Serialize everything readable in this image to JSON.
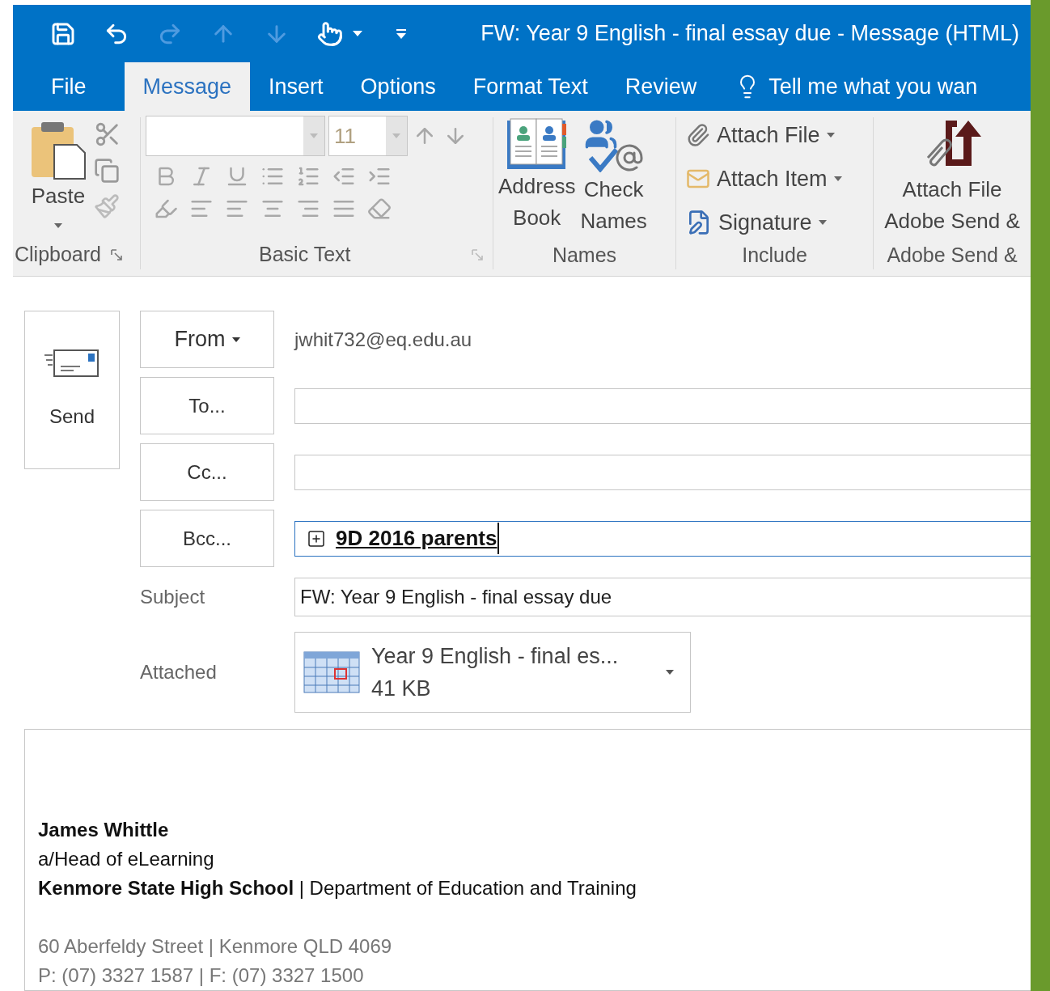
{
  "window": {
    "title": "FW: Year 9 English - final essay due - Message (HTML)"
  },
  "quick_access": [
    {
      "kind": "save",
      "disabled": false
    },
    {
      "kind": "undo",
      "disabled": false
    },
    {
      "kind": "redo",
      "disabled": true
    },
    {
      "kind": "up",
      "disabled": true
    },
    {
      "kind": "down",
      "disabled": true
    },
    {
      "kind": "touch",
      "disabled": false
    },
    {
      "kind": "customize",
      "disabled": false
    }
  ],
  "tabs": [
    {
      "label": "File",
      "selected": false
    },
    {
      "label": "Message",
      "selected": true
    },
    {
      "label": "Insert",
      "selected": false
    },
    {
      "label": "Options",
      "selected": false
    },
    {
      "label": "Format Text",
      "selected": false
    },
    {
      "label": "Review",
      "selected": false
    }
  ],
  "tell_me": "Tell me what you wan",
  "ribbon": {
    "clipboard": {
      "paste": "Paste",
      "label": "Clipboard"
    },
    "basic_text": {
      "font_size": "11",
      "label": "Basic Text",
      "disabled": true
    },
    "names": {
      "buttons": [
        {
          "kind": "address_book",
          "lines": [
            "Address",
            "Book"
          ]
        },
        {
          "kind": "check_names",
          "lines": [
            "Check",
            "Names"
          ]
        }
      ],
      "label": "Names"
    },
    "include": {
      "items": [
        {
          "kind": "attach_file",
          "label": "Attach File"
        },
        {
          "kind": "attach_item",
          "label": "Attach Item"
        },
        {
          "kind": "signature",
          "label": "Signature"
        }
      ],
      "label": "Include"
    },
    "adobe": {
      "lines": [
        "Attach File",
        "Adobe Send &"
      ],
      "label": "Adobe Send &"
    }
  },
  "send": "Send",
  "from": {
    "button": "From",
    "value": "jwhit732@eq.edu.au"
  },
  "to": {
    "button": "To..."
  },
  "cc": {
    "button": "Cc..."
  },
  "bcc": {
    "button": "Bcc...",
    "value": "9D 2016 parents"
  },
  "subject": {
    "label": "Subject",
    "value": "FW: Year 9 English - final essay due"
  },
  "attached": {
    "label": "Attached",
    "name": "Year 9 English - final es...",
    "size": "41 KB"
  },
  "signature": [
    {
      "kind": "name",
      "text": "James Whittle"
    },
    {
      "kind": "plain",
      "text": "a/Head of eLearning"
    },
    {
      "kind": "plain",
      "text": "**Kenmore State High School** | Department of Education and Training"
    },
    {
      "kind": "gap"
    },
    {
      "kind": "muted",
      "text": "60 Aberfeldy Street | Kenmore QLD 4069"
    },
    {
      "kind": "muted",
      "text": "P: (07) 3327 1587 | F: (07) 3327 1500"
    }
  ]
}
